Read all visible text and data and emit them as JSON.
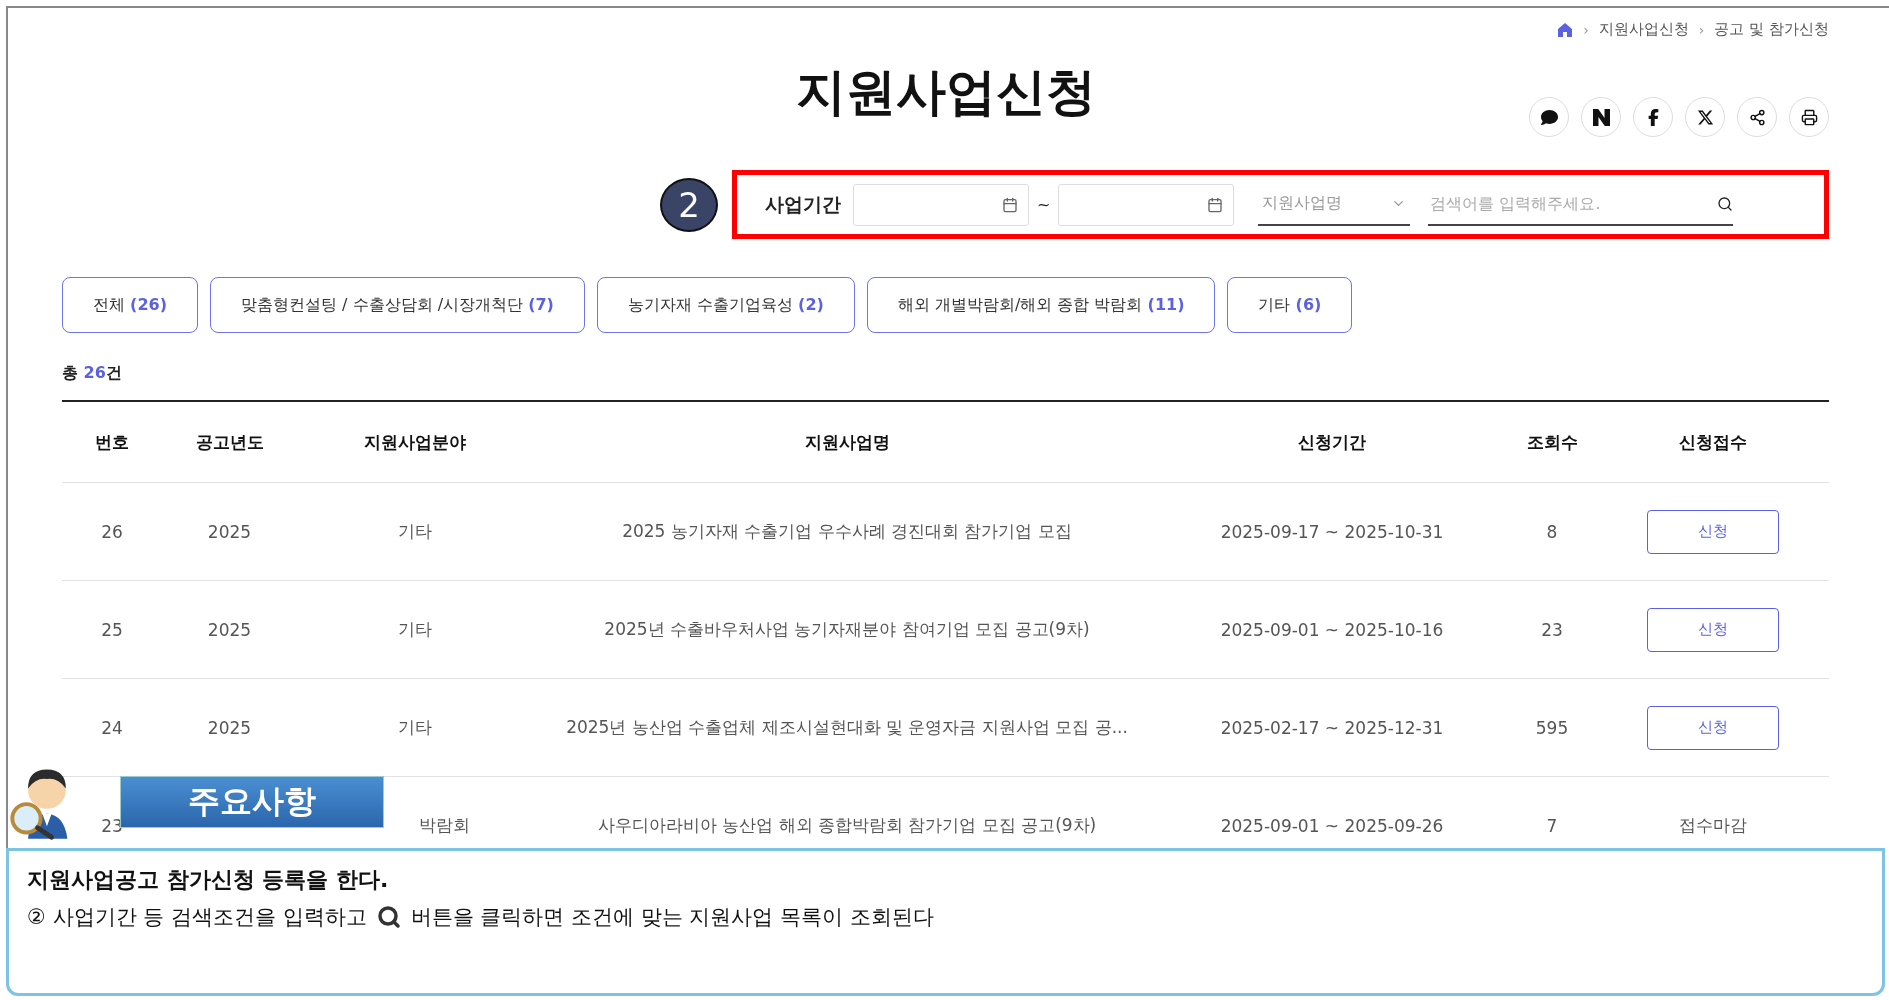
{
  "breadcrumb": {
    "separator": "›",
    "items": [
      "지원사업신청",
      "공고 및 참가신청"
    ]
  },
  "title": "지원사업신청",
  "search": {
    "step_marker": "2",
    "label": "사업기간",
    "date_separator": "~",
    "select": {
      "value": "지원사업명"
    },
    "keyword": {
      "placeholder": "검색어를 입력해주세요."
    }
  },
  "tabs": [
    {
      "label": "전체",
      "count": "(26)",
      "selected": false
    },
    {
      "label": "맞춤형컨설팅 / 수출상담회 /시장개척단",
      "count": "(7)",
      "selected": false
    },
    {
      "label": "농기자재 수출기업육성",
      "count": "(2)",
      "selected": false
    },
    {
      "label": "해외 개별박람회/해외 종합 박람회",
      "count": "(11)",
      "selected": false
    },
    {
      "label": "기타",
      "count": "(6)",
      "selected": false
    }
  ],
  "total": {
    "prefix": "총",
    "count": "26",
    "suffix": "건"
  },
  "table": {
    "columns": [
      "번호",
      "공고년도",
      "지원사업분야",
      "지원사업명",
      "신청기간",
      "조회수",
      "신청접수"
    ],
    "rows": [
      {
        "cells": [
          "26",
          "2025",
          "기타",
          "2025 농기자재 수출기업 우수사례 경진대회 참가기업 모집",
          "2025-09-17 ~ 2025-10-31",
          "8"
        ],
        "apply": {
          "kind": "button",
          "label": "신청"
        }
      },
      {
        "cells": [
          "25",
          "2025",
          "기타",
          "2025년 수출바우처사업 농기자재분야 참여기업 모집 공고(9차)",
          "2025-09-01 ~ 2025-10-16",
          "23"
        ],
        "apply": {
          "kind": "button",
          "label": "신청"
        }
      },
      {
        "cells": [
          "24",
          "2025",
          "기타",
          "2025년 농산업 수출업체 제조시설현대화 및 운영자금 지원사업 모집 공...",
          "2025-02-17 ~ 2025-12-31",
          "595"
        ],
        "apply": {
          "kind": "button",
          "label": "신청"
        }
      },
      {
        "cells": [
          "23",
          null,
          "박람회",
          "사우디아라비아 농산업 해외 종합박람회 참가기업 모집 공고(9차)",
          "2025-09-01 ~ 2025-09-26",
          "7"
        ],
        "apply": {
          "kind": "text",
          "label": "접수마감"
        }
      }
    ]
  },
  "callout": {
    "title": "주요사항"
  },
  "note": {
    "heading": "지원사업공고 참가신청 등록을 한다.",
    "line_before": "② 사업기간 등 검색조건을 입력하고",
    "line_after": "버튼을 클릭하면 조건에 맞는 지원사업 목록이 조회된다"
  }
}
